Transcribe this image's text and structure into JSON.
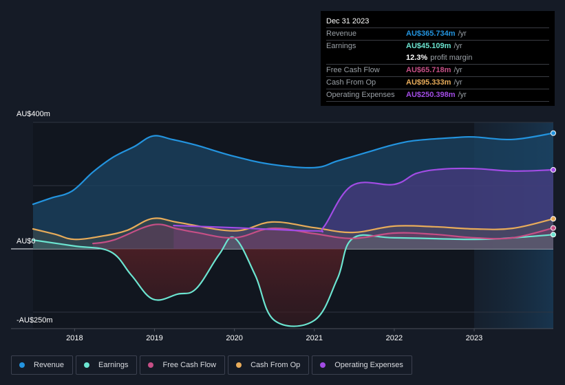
{
  "tooltip": {
    "date": "Dec 31 2023",
    "rows": [
      {
        "label": "Revenue",
        "value": "AU$365.734m",
        "unit": "/yr",
        "color": "#2394df"
      },
      {
        "label": "Earnings",
        "value": "AU$45.109m",
        "unit": "/yr",
        "color": "#6ce5d1"
      },
      {
        "label": "",
        "value": "12.3%",
        "unit": "profit margin",
        "color": "#ffffff"
      },
      {
        "label": "Free Cash Flow",
        "value": "AU$65.718m",
        "unit": "/yr",
        "color": "#c64f86"
      },
      {
        "label": "Cash From Op",
        "value": "AU$95.333m",
        "unit": "/yr",
        "color": "#e8ac5a"
      },
      {
        "label": "Operating Expenses",
        "value": "AU$250.398m",
        "unit": "/yr",
        "color": "#a24ce5"
      }
    ]
  },
  "legend": [
    {
      "label": "Revenue",
      "color": "#2394df"
    },
    {
      "label": "Earnings",
      "color": "#6ce5d1"
    },
    {
      "label": "Free Cash Flow",
      "color": "#c64f86"
    },
    {
      "label": "Cash From Op",
      "color": "#e8ac5a"
    },
    {
      "label": "Operating Expenses",
      "color": "#a24ce5"
    }
  ],
  "chart_data": {
    "type": "area",
    "title": "",
    "xlabel": "",
    "ylabel": "",
    "unit": "AU$ millions",
    "x_ticks": [
      "2018",
      "2019",
      "2020",
      "2021",
      "2022",
      "2023"
    ],
    "y_tick_labels": [
      {
        "value": 400,
        "label": "AU$400m"
      },
      {
        "value": 0,
        "label": "AU$0"
      },
      {
        "value": -250,
        "label": "-AU$250m"
      }
    ],
    "gridlines": [
      400,
      200,
      0,
      -200
    ],
    "xlim": [
      2017.48,
      2023.99
    ],
    "ylim": [
      -250,
      400
    ],
    "highlight_start": 2023.0,
    "series": [
      {
        "name": "Revenue",
        "color": "#2394df",
        "x": [
          2017.48,
          2017.71,
          2017.97,
          2018.23,
          2018.49,
          2018.75,
          2018.98,
          2019.22,
          2019.52,
          2019.99,
          2020.47,
          2021.0,
          2021.29,
          2021.64,
          2022.0,
          2022.28,
          2022.76,
          2023.0,
          2023.48,
          2023.99
        ],
        "values": [
          141,
          161,
          183,
          243,
          291,
          324,
          357,
          346,
          328,
          293,
          267,
          257,
          278,
          304,
          330,
          343,
          352,
          354,
          346,
          366
        ]
      },
      {
        "name": "Earnings",
        "color": "#6ce5d1",
        "x": [
          2017.48,
          2018.0,
          2018.45,
          2018.71,
          2018.98,
          2019.29,
          2019.52,
          2019.81,
          2020.0,
          2020.26,
          2020.5,
          2021.0,
          2021.29,
          2021.48,
          2022.0,
          2023.0,
          2023.48,
          2023.99
        ],
        "values": [
          28,
          9,
          -9,
          -83,
          -159,
          -143,
          -126,
          -17,
          35,
          -83,
          -226,
          -226,
          -93,
          33,
          35,
          30,
          35,
          45
        ]
      },
      {
        "name": "Free Cash Flow",
        "color": "#c64f86",
        "x": [
          2018.23,
          2018.49,
          2018.98,
          2019.29,
          2019.52,
          2020.0,
          2020.47,
          2021.0,
          2021.48,
          2022.0,
          2022.5,
          2023.0,
          2023.48,
          2023.99
        ],
        "values": [
          17,
          28,
          76,
          63,
          52,
          35,
          65,
          48,
          33,
          50,
          46,
          35,
          35,
          66
        ]
      },
      {
        "name": "Cash From Op",
        "color": "#e8ac5a",
        "x": [
          2017.48,
          2017.76,
          2018.0,
          2018.36,
          2018.66,
          2018.98,
          2019.31,
          2020.0,
          2020.47,
          2021.0,
          2021.48,
          2022.0,
          2022.5,
          2023.0,
          2023.48,
          2023.99
        ],
        "values": [
          63,
          46,
          30,
          41,
          59,
          96,
          83,
          57,
          85,
          67,
          52,
          72,
          70,
          63,
          65,
          95
        ]
      },
      {
        "name": "Operating Expenses",
        "color": "#a24ce5",
        "x": [
          2019.24,
          2020.0,
          2021.0,
          2021.12,
          2021.47,
          2022.0,
          2022.28,
          2022.59,
          2023.0,
          2023.48,
          2023.99
        ],
        "values": [
          74,
          67,
          57,
          70,
          200,
          204,
          239,
          252,
          254,
          246,
          250
        ]
      }
    ]
  }
}
